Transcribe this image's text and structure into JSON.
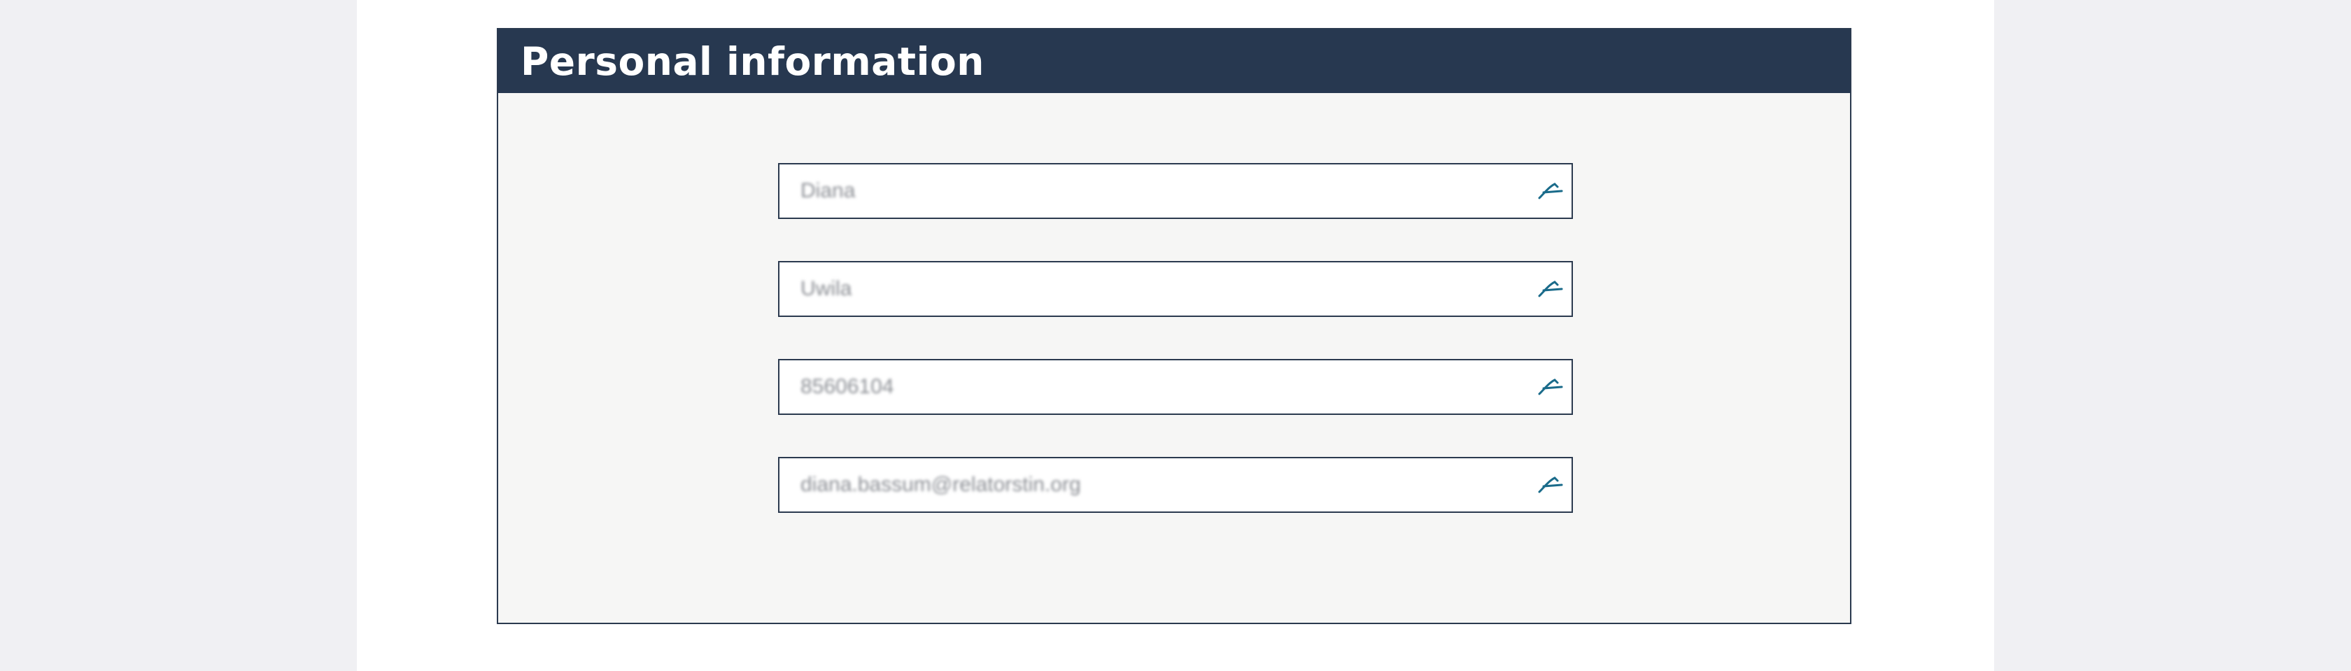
{
  "panel": {
    "title": "Personal information"
  },
  "fields": [
    {
      "value": "Diana",
      "icon": "autofill-icon"
    },
    {
      "value": "Uwila",
      "icon": "autofill-icon"
    },
    {
      "value": "85606104",
      "icon": "autofill-icon"
    },
    {
      "value": "diana.bassum@relatorstin.org",
      "icon": "autofill-icon"
    }
  ],
  "colors": {
    "header_bg": "#273850",
    "panel_bg": "#f6f6f5",
    "page_bg": "#f0f0f3",
    "border": "#2b3a4f",
    "icon": "#1a6b8a"
  }
}
